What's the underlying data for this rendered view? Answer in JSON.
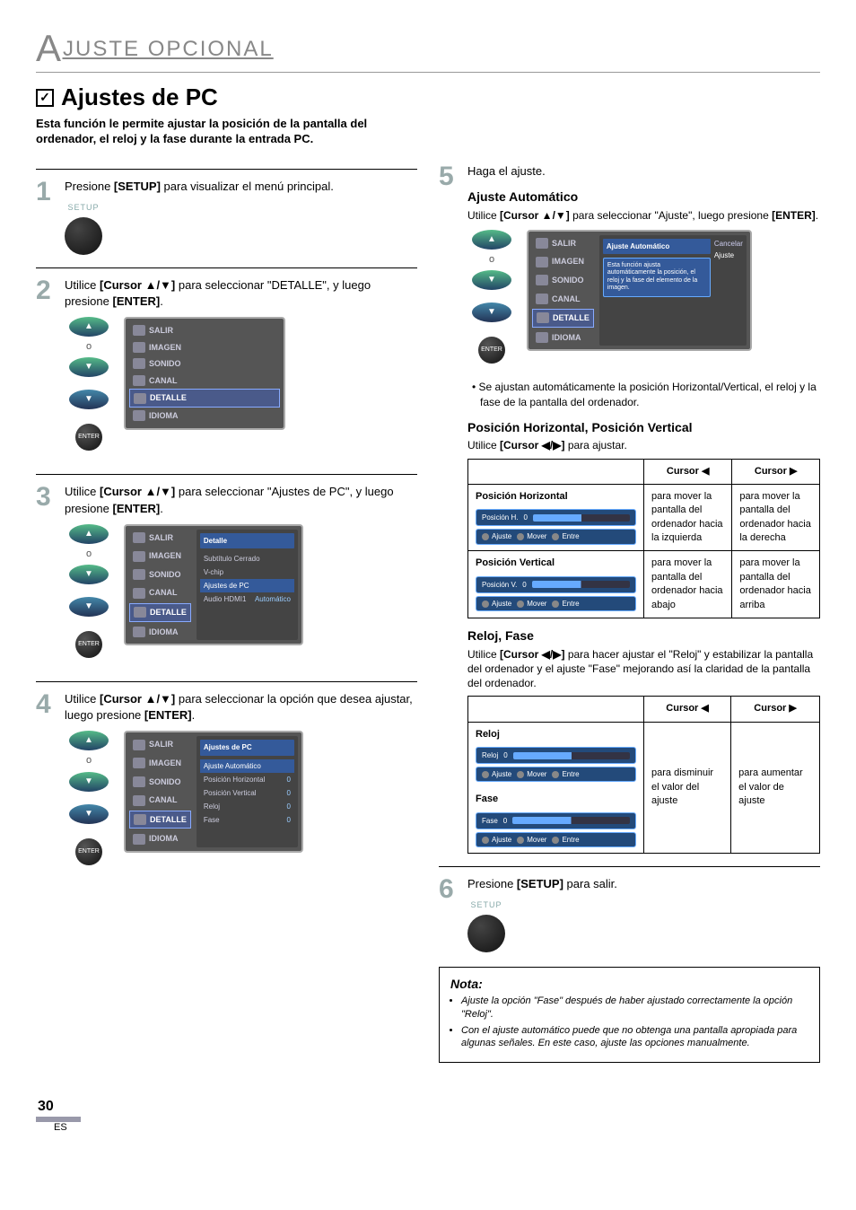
{
  "header": {
    "title_letter": "A",
    "title_rest": "JUSTE OPCIONAL"
  },
  "section": {
    "check": "✓",
    "title": "Ajustes de PC",
    "intro": "Esta función le permite ajustar la posición de la pantalla del ordenador, el reloj y la fase durante la entrada PC."
  },
  "menu_labels": {
    "salir": "SALIR",
    "imagen": "IMAGEN",
    "sonido": "SONIDO",
    "canal": "CANAL",
    "detalle": "DETALLE",
    "idioma": "IDIOMA"
  },
  "detalle_panel": {
    "header": "Detalle",
    "items": [
      "Subtítulo Cerrado",
      "V-chip",
      "Ajustes de PC"
    ],
    "audio_label": "Audio HDMI1",
    "audio_value": "Automático"
  },
  "pc_panel": {
    "header": "Ajustes de PC",
    "auto": "Ajuste Automático",
    "items": [
      {
        "label": "Posición Horizontal",
        "value": "0"
      },
      {
        "label": "Posición Vertical",
        "value": "0"
      },
      {
        "label": "Reloj",
        "value": "0"
      },
      {
        "label": "Fase",
        "value": "0"
      }
    ]
  },
  "auto_panel": {
    "header": "Ajuste Automático",
    "desc": "Esta función ajusta automáticamente la posición, el reloj y la fase del elemento de la imagen.",
    "cancelar": "Cancelar",
    "ajuste": "Ajuste"
  },
  "osd_buttons": {
    "ajuste": "Ajuste",
    "mover": "Mover",
    "entre": "Entre"
  },
  "remote": {
    "setup": "SETUP",
    "enter": "ENTER",
    "o": "o"
  },
  "steps": {
    "s1": {
      "num": "1",
      "text_a": "Presione ",
      "bold1": "[SETUP]",
      "text_b": " para visualizar el menú principal."
    },
    "s2": {
      "num": "2",
      "text_a": "Utilice ",
      "bold1": "[Cursor ▲/▼]",
      "text_b": " para seleccionar \"DETALLE\", y luego presione ",
      "bold2": "[ENTER]",
      "text_c": "."
    },
    "s3": {
      "num": "3",
      "text_a": "Utilice ",
      "bold1": "[Cursor ▲/▼]",
      "text_b": " para seleccionar \"Ajustes de PC\", y luego presione ",
      "bold2": "[ENTER]",
      "text_c": "."
    },
    "s4": {
      "num": "4",
      "text_a": "Utilice ",
      "bold1": "[Cursor ▲/▼]",
      "text_b": " para seleccionar la opción que desea ajustar, luego presione ",
      "bold2": "[ENTER]",
      "text_c": "."
    },
    "s5": {
      "num": "5",
      "text_a": "Haga el ajuste."
    },
    "s6": {
      "num": "6",
      "text_a": "Presione ",
      "bold1": "[SETUP]",
      "text_b": " para salir."
    }
  },
  "step5": {
    "auto_head": "Ajuste Automático",
    "auto_text_a": "Utilice ",
    "auto_bold1": "[Cursor ▲/▼]",
    "auto_text_b": " para seleccionar \"Ajuste\", luego presione ",
    "auto_bold2": "[ENTER]",
    "auto_text_c": ".",
    "auto_bullet": "Se ajustan automáticamente la posición Horizontal/Vertical, el reloj y la fase de la pantalla del ordenador.",
    "pos_head": "Posición Horizontal, Posición Vertical",
    "pos_text_a": "Utilice ",
    "pos_bold1": "[Cursor ◀/▶]",
    "pos_text_b": " para ajustar.",
    "table_pos": {
      "h_empty": "",
      "h_left": "Cursor ◀",
      "h_right": "Cursor ▶",
      "rows": [
        {
          "name": "Posición Horizontal",
          "osd_label": "Posición H.",
          "osd_val": "0",
          "left": "para mover la pantalla del ordenador hacia la izquierda",
          "right": "para mover la pantalla del ordenador hacia la derecha"
        },
        {
          "name": "Posición Vertical",
          "osd_label": "Posición V.",
          "osd_val": "0",
          "left": "para mover la pantalla del ordenador hacia abajo",
          "right": "para mover la pantalla del ordenador hacia arriba"
        }
      ]
    },
    "clock_head": "Reloj, Fase",
    "clock_text_a": "Utilice ",
    "clock_bold1": "[Cursor ◀/▶]",
    "clock_text_b": " para hacer ajustar el \"Reloj\" y estabilizar la pantalla del ordenador y el ajuste \"Fase\" mejorando así la claridad de la pantalla del ordenador.",
    "table_clock": {
      "h_left": "Cursor ◀",
      "h_right": "Cursor ▶",
      "rows": [
        {
          "name": "Reloj",
          "osd_label": "Reloj",
          "osd_val": "0"
        },
        {
          "name": "Fase",
          "osd_label": "Fase",
          "osd_val": "0"
        }
      ],
      "left_desc": "para disminuir el valor del ajuste",
      "right_desc": "para aumentar el valor de ajuste"
    }
  },
  "note": {
    "title": "Nota:",
    "items": [
      "Ajuste la opción \"Fase\" después de haber ajustado correctamente la opción \"Reloj\".",
      "Con el ajuste automático puede que no obtenga una pantalla apropiada para algunas señales. En este caso, ajuste las opciones manualmente."
    ]
  },
  "footer": {
    "page": "30",
    "lang": "ES"
  }
}
